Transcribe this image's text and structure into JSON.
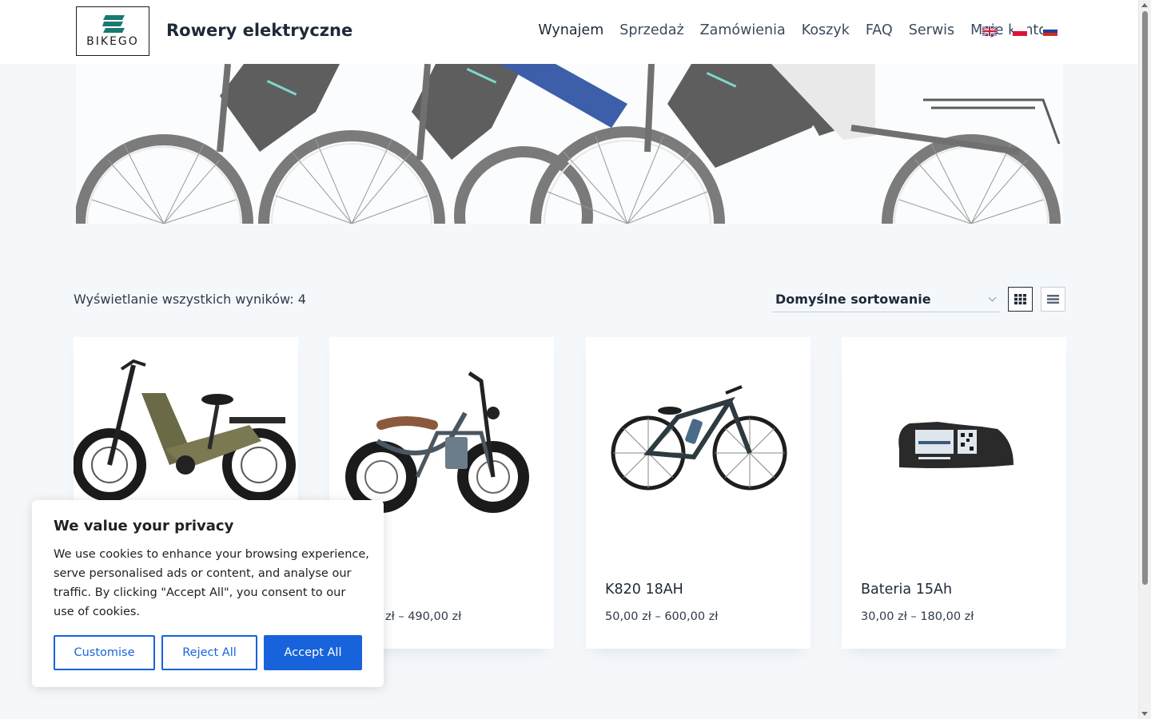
{
  "header": {
    "logo_text": "BIKEGO",
    "site_title": "Rowery elektryczne",
    "nav": [
      {
        "label": "Wynajem",
        "active": true
      },
      {
        "label": "Sprzedaż"
      },
      {
        "label": "Zamówienia"
      },
      {
        "label": "Koszyk"
      },
      {
        "label": "FAQ"
      },
      {
        "label": "Serwis"
      },
      {
        "label": "Moje konto"
      }
    ],
    "languages": [
      "uk-flag-icon",
      "pl-flag-icon",
      "ru-flag-icon"
    ]
  },
  "shop": {
    "results_text": "Wyświetlanie wszystkich wyników: 4",
    "sort_selected": "Domyślne sortowanie",
    "view_modes": [
      "grid-view-icon",
      "list-view-icon"
    ]
  },
  "products": [
    {
      "name": "",
      "price": "",
      "image": "fat-tire-step-through-ebike"
    },
    {
      "name": "",
      "price": "zł – 490,00 zł",
      "image": "moped-style-ebike"
    },
    {
      "name": "K820 18AH",
      "price": "50,00 zł – 600,00 zł",
      "image": "mountain-ebike"
    },
    {
      "name": "Bateria 15Ah",
      "price": "30,00 zł – 180,00 zł",
      "image": "bikego-battery"
    }
  ],
  "cookie": {
    "title": "We value your privacy",
    "text": "We use cookies to enhance your browsing experience, serve personalised ads or content, and analyse our traffic. By clicking \"Accept All\", you consent to our use of cookies.",
    "customise": "Customise",
    "reject": "Reject All",
    "accept": "Accept All"
  },
  "colors": {
    "accent_blue": "#1863dc",
    "page_bg": "#f5f8fb",
    "text_dark": "#1e2937"
  }
}
